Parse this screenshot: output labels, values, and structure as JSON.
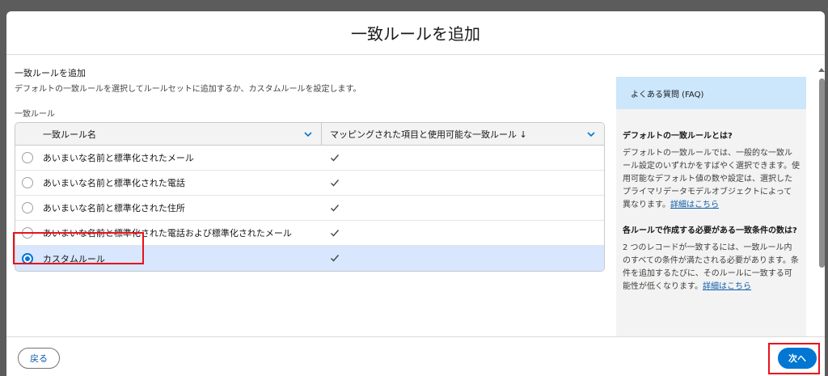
{
  "modal": {
    "title": "一致ルールを追加"
  },
  "section": {
    "title": "一致ルールを追加",
    "description": "デフォルトの一致ルールを選択してルールセットに追加するか、カスタムルールを設定します。"
  },
  "field": {
    "label": "一致ルール"
  },
  "table": {
    "columns": [
      "一致ルール名",
      "マッピングされた項目と使用可能な一致ルール ↓"
    ],
    "rows": [
      {
        "name": "あいまいな名前と標準化されたメール",
        "selected": false
      },
      {
        "name": "あいまいな名前と標準化された電話",
        "selected": false
      },
      {
        "name": "あいまいな名前と標準化された住所",
        "selected": false
      },
      {
        "name": "あいまいな名前と標準化された電話および標準化されたメール",
        "selected": false
      },
      {
        "name": "カスタムルール",
        "selected": true
      }
    ]
  },
  "faq": {
    "header": "よくある質問 (FAQ)",
    "q1": "デフォルトの一致ルールとは?",
    "a1": "デフォルトの一致ルールでは、一般的な一致ルール設定のいずれかをすばやく選択できます。使用可能なデフォルト値の数や設定は、選択したプライマリデータモデルオブジェクトによって異なります。",
    "a1_link": "詳細はこちら",
    "q2": "各ルールで作成する必要がある一致条件の数は?",
    "a2": "2 つのレコードが一致するには、一致ルール内のすべての条件が満たされる必要があります。条件を追加するたびに、そのルールに一致する可能性が低くなります。",
    "a2_link": "詳細はこちら"
  },
  "footer": {
    "back_label": "戻る",
    "next_label": "次へ"
  },
  "colors": {
    "brand": "#0176d3",
    "highlight": "#e8121a",
    "selected_row": "#d8e6fe",
    "faq_header": "#cce6fb"
  },
  "icons": {
    "column_menu": "chevron-down-icon",
    "mapped": "check-icon",
    "sort": "arrow-down-icon"
  }
}
